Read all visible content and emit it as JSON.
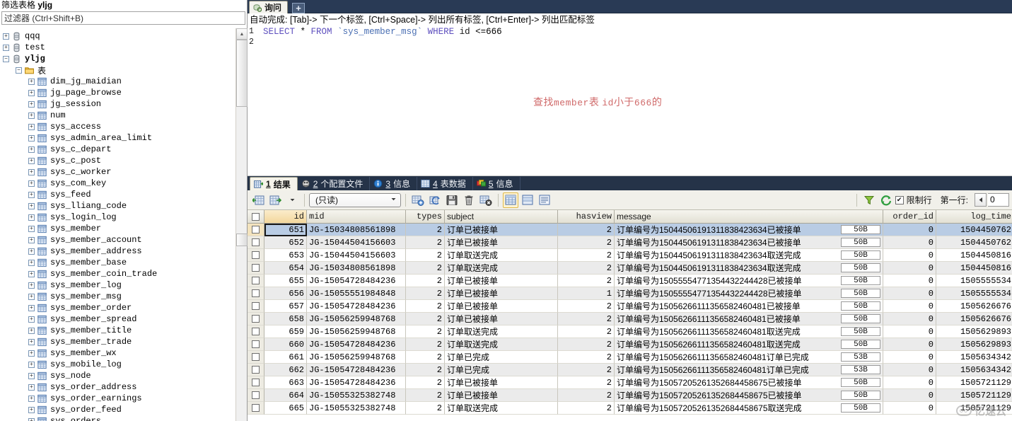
{
  "sidebar": {
    "title_prefix": "筛选表格",
    "title_db": "yljg",
    "filter_placeholder": "过滤器 (Ctrl+Shift+B)",
    "tree": [
      {
        "label": "qqq",
        "depth": 0,
        "icon": "database-icon",
        "state": "collapsed",
        "bold": false,
        "cjk": false
      },
      {
        "label": "test",
        "depth": 0,
        "icon": "database-icon",
        "state": "collapsed",
        "bold": false,
        "cjk": false
      },
      {
        "label": "yljg",
        "depth": 0,
        "icon": "database-icon",
        "state": "expanded",
        "bold": true,
        "cjk": false
      },
      {
        "label": "表",
        "depth": 1,
        "icon": "folder-icon",
        "state": "expanded",
        "bold": false,
        "cjk": true
      },
      {
        "label": "dim_jg_maidian",
        "depth": 2,
        "icon": "table-icon",
        "state": "collapsed",
        "bold": false,
        "cjk": false
      },
      {
        "label": "jg_page_browse",
        "depth": 2,
        "icon": "table-icon",
        "state": "collapsed",
        "bold": false,
        "cjk": false
      },
      {
        "label": "jg_session",
        "depth": 2,
        "icon": "table-icon",
        "state": "collapsed",
        "bold": false,
        "cjk": false
      },
      {
        "label": "num",
        "depth": 2,
        "icon": "table-icon",
        "state": "collapsed",
        "bold": false,
        "cjk": false
      },
      {
        "label": "sys_access",
        "depth": 2,
        "icon": "table-icon",
        "state": "collapsed",
        "bold": false,
        "cjk": false
      },
      {
        "label": "sys_admin_area_limit",
        "depth": 2,
        "icon": "table-icon",
        "state": "collapsed",
        "bold": false,
        "cjk": false
      },
      {
        "label": "sys_c_depart",
        "depth": 2,
        "icon": "table-icon",
        "state": "collapsed",
        "bold": false,
        "cjk": false
      },
      {
        "label": "sys_c_post",
        "depth": 2,
        "icon": "table-icon",
        "state": "collapsed",
        "bold": false,
        "cjk": false
      },
      {
        "label": "sys_c_worker",
        "depth": 2,
        "icon": "table-icon",
        "state": "collapsed",
        "bold": false,
        "cjk": false
      },
      {
        "label": "sys_com_key",
        "depth": 2,
        "icon": "table-icon",
        "state": "collapsed",
        "bold": false,
        "cjk": false
      },
      {
        "label": "sys_feed",
        "depth": 2,
        "icon": "table-icon",
        "state": "collapsed",
        "bold": false,
        "cjk": false
      },
      {
        "label": "sys_lliang_code",
        "depth": 2,
        "icon": "table-icon",
        "state": "collapsed",
        "bold": false,
        "cjk": false
      },
      {
        "label": "sys_login_log",
        "depth": 2,
        "icon": "table-icon",
        "state": "collapsed",
        "bold": false,
        "cjk": false
      },
      {
        "label": "sys_member",
        "depth": 2,
        "icon": "table-icon",
        "state": "collapsed",
        "bold": false,
        "cjk": false
      },
      {
        "label": "sys_member_account",
        "depth": 2,
        "icon": "table-icon",
        "state": "collapsed",
        "bold": false,
        "cjk": false
      },
      {
        "label": "sys_member_address",
        "depth": 2,
        "icon": "table-icon",
        "state": "collapsed",
        "bold": false,
        "cjk": false
      },
      {
        "label": "sys_member_base",
        "depth": 2,
        "icon": "table-icon",
        "state": "collapsed",
        "bold": false,
        "cjk": false
      },
      {
        "label": "sys_member_coin_trade",
        "depth": 2,
        "icon": "table-icon",
        "state": "collapsed",
        "bold": false,
        "cjk": false
      },
      {
        "label": "sys_member_log",
        "depth": 2,
        "icon": "table-icon",
        "state": "collapsed",
        "bold": false,
        "cjk": false
      },
      {
        "label": "sys_member_msg",
        "depth": 2,
        "icon": "table-icon",
        "state": "collapsed",
        "bold": false,
        "cjk": false
      },
      {
        "label": "sys_member_order",
        "depth": 2,
        "icon": "table-icon",
        "state": "collapsed",
        "bold": false,
        "cjk": false
      },
      {
        "label": "sys_member_spread",
        "depth": 2,
        "icon": "table-icon",
        "state": "collapsed",
        "bold": false,
        "cjk": false
      },
      {
        "label": "sys_member_title",
        "depth": 2,
        "icon": "table-icon",
        "state": "collapsed",
        "bold": false,
        "cjk": false
      },
      {
        "label": "sys_member_trade",
        "depth": 2,
        "icon": "table-icon",
        "state": "collapsed",
        "bold": false,
        "cjk": false
      },
      {
        "label": "sys_member_wx",
        "depth": 2,
        "icon": "table-icon",
        "state": "collapsed",
        "bold": false,
        "cjk": false
      },
      {
        "label": "sys_mobile_log",
        "depth": 2,
        "icon": "table-icon",
        "state": "collapsed",
        "bold": false,
        "cjk": false
      },
      {
        "label": "sys_node",
        "depth": 2,
        "icon": "table-icon",
        "state": "collapsed",
        "bold": false,
        "cjk": false
      },
      {
        "label": "sys_order_address",
        "depth": 2,
        "icon": "table-icon",
        "state": "collapsed",
        "bold": false,
        "cjk": false
      },
      {
        "label": "sys_order_earnings",
        "depth": 2,
        "icon": "table-icon",
        "state": "collapsed",
        "bold": false,
        "cjk": false
      },
      {
        "label": "sys_order_feed",
        "depth": 2,
        "icon": "table-icon",
        "state": "collapsed",
        "bold": false,
        "cjk": false
      },
      {
        "label": "sys_orders",
        "depth": 2,
        "icon": "table-icon",
        "state": "collapsed",
        "bold": false,
        "cjk": false
      }
    ]
  },
  "query_tabs": {
    "tabs": [
      {
        "label": "询问",
        "icon": "query-icon",
        "active": true
      }
    ],
    "new_tab_label": "+"
  },
  "editor": {
    "autocomplete_hint": "自动完成: [Tab]-> 下一个标签, [Ctrl+Space]-> 列出所有标签, [Ctrl+Enter]-> 列出匹配标签",
    "lines": [
      {
        "no": "1",
        "tokens": [
          {
            "t": "SELECT",
            "c": "kw"
          },
          {
            "t": " * ",
            "c": "op"
          },
          {
            "t": "FROM",
            "c": "kw"
          },
          {
            "t": " ",
            "c": "op"
          },
          {
            "t": "`sys_member_msg`",
            "c": "tbl"
          },
          {
            "t": " ",
            "c": "op"
          },
          {
            "t": "WHERE",
            "c": "kw"
          },
          {
            "t": " ",
            "c": "op"
          },
          {
            "t": "id",
            "c": "ident"
          },
          {
            "t": " <=666",
            "c": "op"
          }
        ]
      },
      {
        "no": "2",
        "tokens": []
      }
    ],
    "annotation": "查找member表 id小于666的"
  },
  "result_tabs": [
    {
      "num": "1",
      "label": "结果",
      "icon": "results-grid-icon",
      "active": true
    },
    {
      "num": "2",
      "label": "个配置文件",
      "icon": "profile-icon",
      "active": false
    },
    {
      "num": "3",
      "label": "信息",
      "icon": "info-icon",
      "active": false
    },
    {
      "num": "4",
      "label": "表数据",
      "icon": "table-data-icon",
      "active": false
    },
    {
      "num": "5",
      "label": "信息",
      "icon": "messages-icon",
      "active": false
    }
  ],
  "grid_toolbar": {
    "mode_value": "(只读)",
    "limit_rows_label": "限制行",
    "limit_rows_checked": true,
    "first_row_label": "第一行:",
    "first_row_value": "0",
    "buttons": [
      {
        "name": "insert-row-button",
        "icon": "grid-insert-icon"
      },
      {
        "name": "export-rows-button",
        "icon": "grid-export-icon"
      },
      {
        "name": "add-record-button",
        "icon": "record-add-icon"
      },
      {
        "name": "refresh-record-button",
        "icon": "record-refresh-icon"
      },
      {
        "name": "save-record-button",
        "icon": "floppy-save-icon"
      },
      {
        "name": "delete-record-button",
        "icon": "trash-icon"
      },
      {
        "name": "cancel-edit-button",
        "icon": "record-cancel-icon"
      },
      {
        "name": "grid-view-button",
        "icon": "view-grid-icon"
      },
      {
        "name": "form-view-button",
        "icon": "view-form-icon"
      },
      {
        "name": "text-view-button",
        "icon": "view-text-icon"
      },
      {
        "name": "filter-button",
        "icon": "funnel-icon"
      },
      {
        "name": "reload-button",
        "icon": "refresh-circular-icon"
      }
    ]
  },
  "grid": {
    "columns": [
      "id",
      "mid",
      "types",
      "subject",
      "hasview",
      "message",
      "order_id",
      "log_time"
    ],
    "sorted_column": "id",
    "selected_row_index": 0,
    "rows": [
      {
        "id": "651",
        "mid": "JG-15034808561898",
        "types": "2",
        "subject": "订单已被接单",
        "hasview": "2",
        "message": "订单编号为1504450619131183842363​4已被接单",
        "size": "50B",
        "order_id": "0",
        "log_time": "1504450762"
      },
      {
        "id": "652",
        "mid": "JG-15044504156603",
        "types": "2",
        "subject": "订单已被接单",
        "hasview": "2",
        "message": "订单编号为15044506191311838423634已被接单",
        "size": "50B",
        "order_id": "0",
        "log_time": "1504450762"
      },
      {
        "id": "653",
        "mid": "JG-15044504156603",
        "types": "2",
        "subject": "订单取送完成",
        "hasview": "2",
        "message": "订单编号为15044506191311838423634取送完成",
        "size": "50B",
        "order_id": "0",
        "log_time": "1504450816"
      },
      {
        "id": "654",
        "mid": "JG-15034808561898",
        "types": "2",
        "subject": "订单取送完成",
        "hasview": "2",
        "message": "订单编号为15044506191311838423634取送完成",
        "size": "50B",
        "order_id": "0",
        "log_time": "1504450816"
      },
      {
        "id": "655",
        "mid": "JG-15054728484236",
        "types": "2",
        "subject": "订单已被接单",
        "hasview": "2",
        "message": "订单编号为15055554771354432244428已被接单",
        "size": "50B",
        "order_id": "0",
        "log_time": "1505555534"
      },
      {
        "id": "656",
        "mid": "JG-15055551984848",
        "types": "2",
        "subject": "订单已被接单",
        "hasview": "1",
        "message": "订单编号为15055554771354432244428已被接单",
        "size": "50B",
        "order_id": "0",
        "log_time": "1505555534"
      },
      {
        "id": "657",
        "mid": "JG-15054728484236",
        "types": "2",
        "subject": "订单已被接单",
        "hasview": "2",
        "message": "订单编号为15056266111356582460481已被接单",
        "size": "50B",
        "order_id": "0",
        "log_time": "1505626676"
      },
      {
        "id": "658",
        "mid": "JG-15056259948768",
        "types": "2",
        "subject": "订单已被接单",
        "hasview": "2",
        "message": "订单编号为15056266111356582460481已被接单",
        "size": "50B",
        "order_id": "0",
        "log_time": "1505626676"
      },
      {
        "id": "659",
        "mid": "JG-15056259948768",
        "types": "2",
        "subject": "订单取送完成",
        "hasview": "2",
        "message": "订单编号为15056266111356582460481取送完成",
        "size": "50B",
        "order_id": "0",
        "log_time": "1505629893"
      },
      {
        "id": "660",
        "mid": "JG-15054728484236",
        "types": "2",
        "subject": "订单取送完成",
        "hasview": "2",
        "message": "订单编号为15056266111356582460481取送完成",
        "size": "50B",
        "order_id": "0",
        "log_time": "1505629893"
      },
      {
        "id": "661",
        "mid": "JG-15056259948768",
        "types": "2",
        "subject": "订单已完成",
        "hasview": "2",
        "message": "订单编号为15056266111356582460481订单已完成",
        "size": "53B",
        "order_id": "0",
        "log_time": "1505634342"
      },
      {
        "id": "662",
        "mid": "JG-15054728484236",
        "types": "2",
        "subject": "订单已完成",
        "hasview": "2",
        "message": "订单编号为15056266111356582460481订单已完成",
        "size": "53B",
        "order_id": "0",
        "log_time": "1505634342"
      },
      {
        "id": "663",
        "mid": "JG-15054728484236",
        "types": "2",
        "subject": "订单已被接单",
        "hasview": "2",
        "message": "订单编号为15057205261352684458675已被接单",
        "size": "50B",
        "order_id": "0",
        "log_time": "1505721129"
      },
      {
        "id": "664",
        "mid": "JG-15055325382748",
        "types": "2",
        "subject": "订单已被接单",
        "hasview": "2",
        "message": "订单编号为15057205261352684458675已被接单",
        "size": "50B",
        "order_id": "0",
        "log_time": "1505721129"
      },
      {
        "id": "665",
        "mid": "JG-15055325382748",
        "types": "2",
        "subject": "订单取送完成",
        "hasview": "2",
        "message": "订单编号为15057205261352684458675取送完成",
        "size": "50B",
        "order_id": "0",
        "log_time": "1505721129"
      }
    ]
  },
  "watermark": {
    "text": "亿速云"
  },
  "colors": {
    "tabstrip_bg": "#293a55",
    "active_tab_bg": "#f5f3ea",
    "selection_blue": "#b9cce4",
    "annotation_red": "#d06a6a",
    "sql_keyword": "#5d4fbe",
    "sql_table": "#4a6fb3"
  }
}
